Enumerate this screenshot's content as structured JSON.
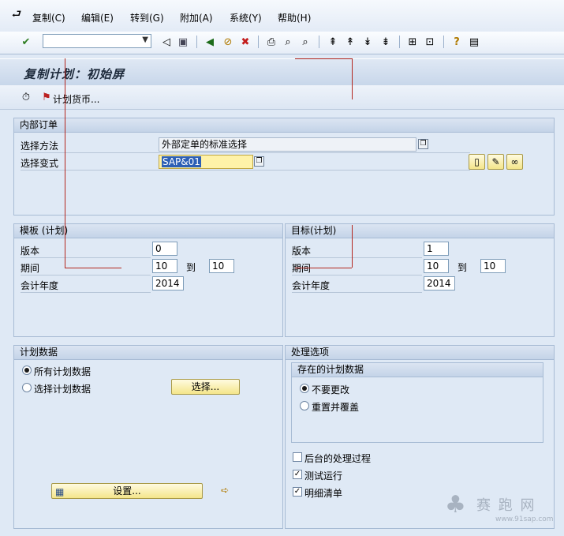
{
  "menu": {
    "items": [
      "复制(C)",
      "编辑(E)",
      "转到(G)",
      "附加(A)",
      "系统(Y)",
      "帮助(H)"
    ]
  },
  "title": "复制计划：初始屏",
  "app_toolbar": {
    "plan_currency_label": "计划货币..."
  },
  "internal_order": {
    "header": "内部订单",
    "selection_method_label": "选择方法",
    "selection_method_value": "外部定单的标准选择",
    "selection_variant_label": "选择变式",
    "selection_variant_value": "SAP&01"
  },
  "template": {
    "header": "模板 (计划)",
    "version_label": "版本",
    "version_value": "0",
    "period_label": "期间",
    "period_from": "10",
    "to_label": "到",
    "period_to": "10",
    "fiscal_year_label": "会计年度",
    "fiscal_year_value": "2014"
  },
  "target": {
    "header": "目标(计划)",
    "version_label": "版本",
    "version_value": "1",
    "period_label": "期间",
    "period_from": "10",
    "to_label": "到",
    "period_to": "10",
    "fiscal_year_label": "会计年度",
    "fiscal_year_value": "2014"
  },
  "plan_data": {
    "header": "计划数据",
    "all_label": "所有计划数据",
    "select_label": "选择计划数据",
    "select_button": "选择...",
    "settings_button": "设置..."
  },
  "processing": {
    "header": "处理选项",
    "existing_header": "存在的计划数据",
    "no_change_label": "不要更改",
    "reset_label": "重置并覆盖",
    "background_label": "后台的处理过程",
    "test_run_label": "测试运行",
    "detail_list_label": "明细清单",
    "background_checked": false,
    "test_run_checked": true,
    "detail_list_checked": true
  },
  "watermark": {
    "text": "赛 跑 网",
    "url": "www.91sap.com"
  }
}
